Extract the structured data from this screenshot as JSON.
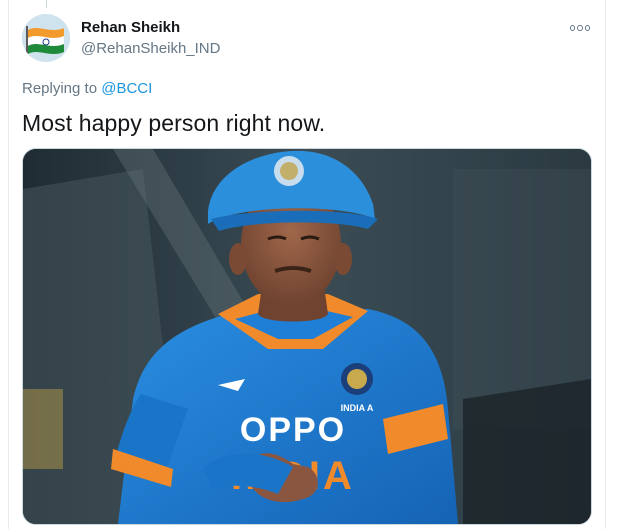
{
  "user": {
    "name": "Rehan Sheikh",
    "handle": "@RehanSheikh_IND"
  },
  "reply": {
    "prefix": "Replying to",
    "mention": "@BCCI"
  },
  "tweet": {
    "text": "Most happy person right now."
  },
  "media": {
    "jersey_sponsor": "OPPO",
    "jersey_text": "INDIA",
    "badge_text": "INDIA A"
  },
  "colors": {
    "jersey_blue": "#1f7fd6",
    "collar_orange": "#f08a2a",
    "link_blue": "#1b95e0"
  }
}
